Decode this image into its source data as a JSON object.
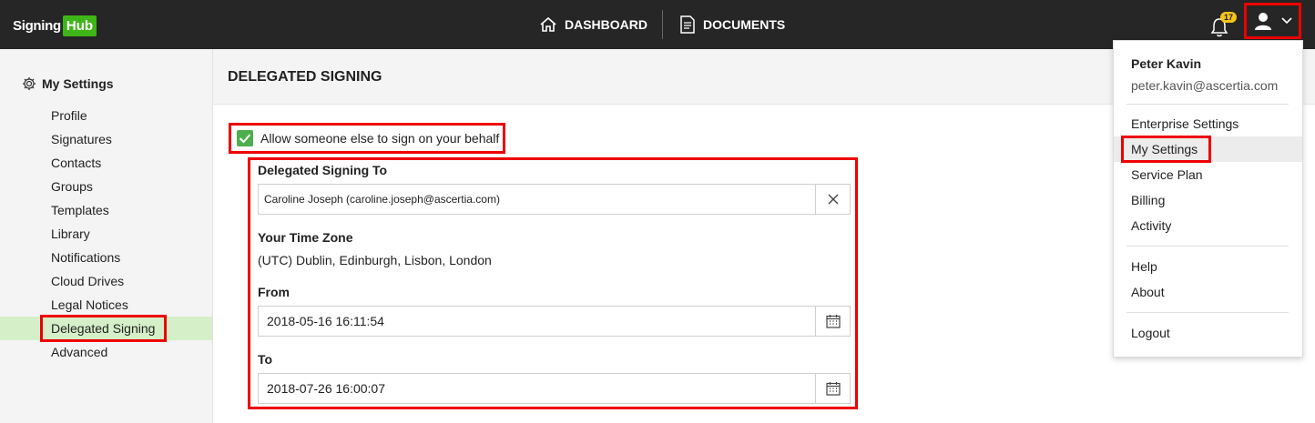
{
  "app": {
    "logo_signing": "Signing",
    "logo_hub": "Hub"
  },
  "nav": {
    "dashboard": "DASHBOARD",
    "documents": "DOCUMENTS"
  },
  "notifications": {
    "count": "17"
  },
  "sidebar": {
    "title": "My Settings",
    "items": [
      "Profile",
      "Signatures",
      "Contacts",
      "Groups",
      "Templates",
      "Library",
      "Notifications",
      "Cloud Drives",
      "Legal Notices",
      "Delegated Signing",
      "Advanced"
    ],
    "active": "Delegated Signing"
  },
  "page": {
    "title": "DELEGATED SIGNING",
    "allow_label": "Allow someone else to sign on your behalf",
    "allow_checked": true,
    "delegate_label": "Delegated Signing To",
    "delegate_value": "Caroline Joseph (caroline.joseph@ascertia.com)",
    "timezone_label": "Your Time Zone",
    "timezone_value": "(UTC) Dublin, Edinburgh, Lisbon, London",
    "from_label": "From",
    "from_value": "2018-05-16 16:11:54",
    "to_label": "To",
    "to_value": "2018-07-26 16:00:07"
  },
  "user_menu": {
    "name": "Peter Kavin",
    "email": "peter.kavin@ascertia.com",
    "items": {
      "enterprise_settings": "Enterprise Settings",
      "my_settings": "My Settings",
      "service_plan": "Service Plan",
      "billing": "Billing",
      "activity": "Activity",
      "help": "Help",
      "about": "About",
      "logout": "Logout"
    }
  },
  "colors": {
    "topbar": "#262626",
    "brand_green": "#3fb618",
    "highlight_red": "#ee0000",
    "active_green_bg": "#d5efc8",
    "badge_yellow": "#f5c518"
  },
  "icons": {
    "dashboard": "home-icon",
    "documents": "document-icon",
    "notifications": "bell-icon",
    "user": "user-icon",
    "settings": "gear-icon",
    "clear": "close-icon",
    "calendar": "calendar-icon"
  }
}
